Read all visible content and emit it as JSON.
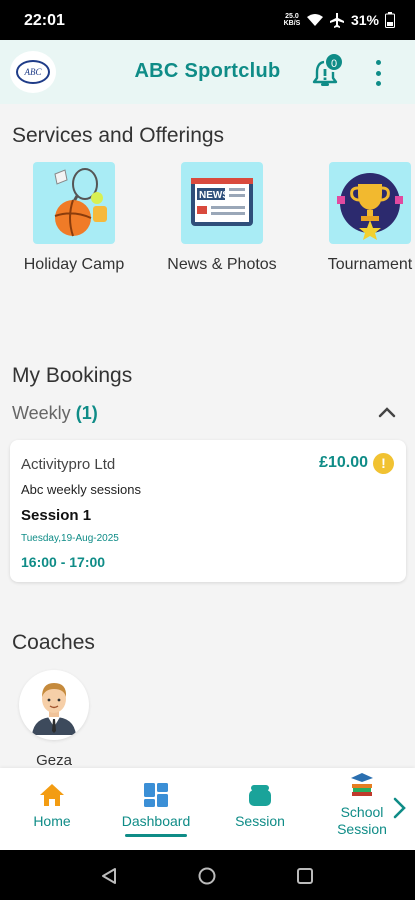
{
  "status_bar": {
    "time": "22:01",
    "battery": "31%",
    "mini_label": "25.0 KB/S"
  },
  "header": {
    "title": "ABC Sportclub",
    "logo_text": "ABC",
    "notification_count": "0"
  },
  "services": {
    "title": "Services and Offerings",
    "items": [
      {
        "label": "Holiday Camp"
      },
      {
        "label": "News & Photos",
        "tile_text": "NEWS"
      },
      {
        "label": "Tournament"
      }
    ]
  },
  "bookings": {
    "title": "My Bookings",
    "group_label": "Weekly",
    "group_count": "(1)",
    "card": {
      "provider": "Activitypro Ltd",
      "price": "£10.00",
      "coin_symbol": "!",
      "activity": "Abc weekly sessions",
      "session": "Session 1",
      "date": "Tuesday,19-Aug-2025",
      "time": "16:00 - 17:00"
    }
  },
  "coaches": {
    "title": "Coaches",
    "items": [
      {
        "name": "Geza"
      }
    ]
  },
  "bottom_nav": {
    "items": [
      {
        "label": "Home"
      },
      {
        "label": "Dashboard",
        "active": true
      },
      {
        "label": "Session"
      },
      {
        "label": "School\nSession"
      }
    ]
  },
  "colors": {
    "accent": "#0f8c87",
    "header_bg": "#e9f6f4",
    "tile_bg": "#a9ecf5",
    "coin": "#f1c232"
  }
}
